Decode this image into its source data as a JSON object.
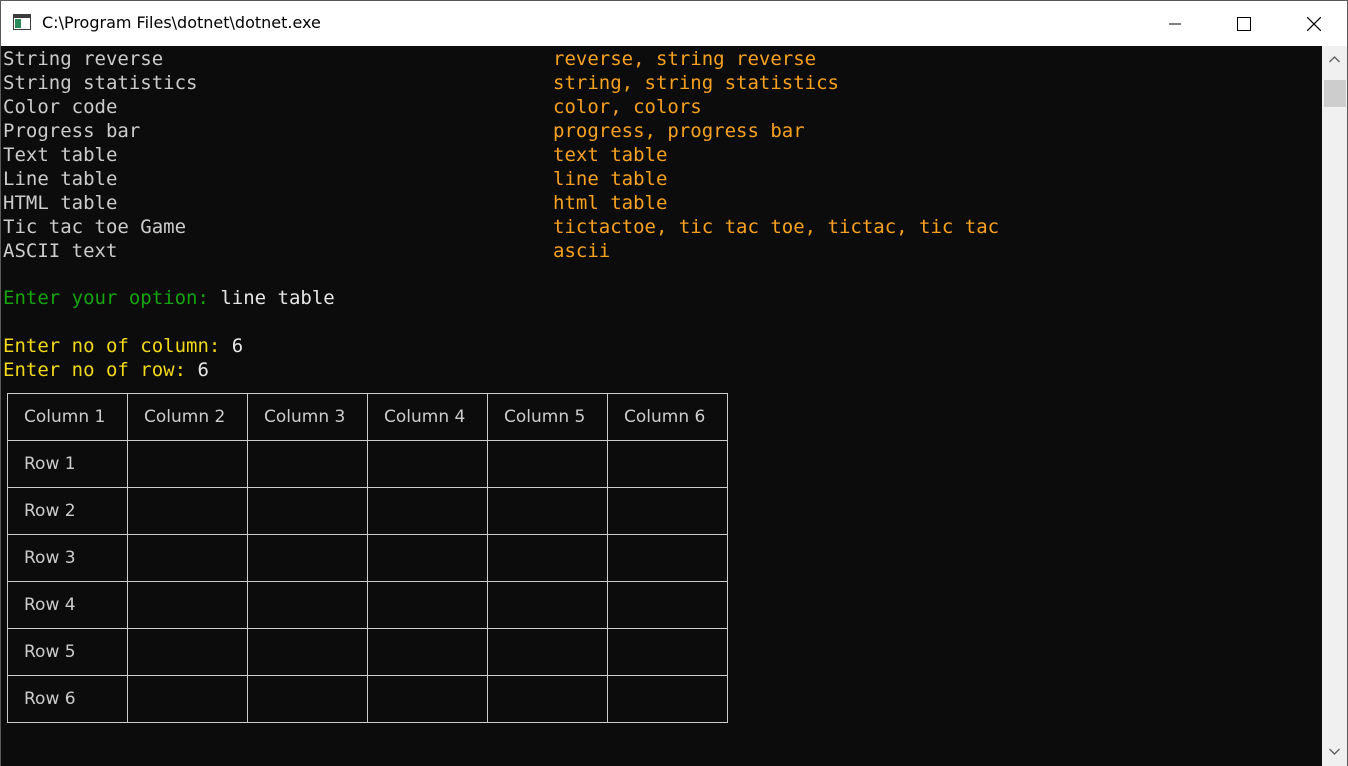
{
  "window": {
    "title": "C:\\Program Files\\dotnet\\dotnet.exe",
    "app_icon": "console-icon",
    "controls": {
      "minimize": "minimize-icon",
      "maximize": "maximize-icon",
      "close": "close-icon"
    }
  },
  "menu": [
    {
      "name": "String reverse",
      "aliases": "reverse, string reverse"
    },
    {
      "name": "String statistics",
      "aliases": "string, string statistics"
    },
    {
      "name": "Color code",
      "aliases": "color, colors"
    },
    {
      "name": "Progress bar",
      "aliases": "progress, progress bar"
    },
    {
      "name": "Text table",
      "aliases": "text table"
    },
    {
      "name": "Line table",
      "aliases": "line table"
    },
    {
      "name": "HTML table",
      "aliases": "html table"
    },
    {
      "name": "Tic tac toe Game",
      "aliases": "tictactoe, tic tac toe, tictac, tic tac"
    },
    {
      "name": "ASCII text",
      "aliases": "ascii"
    }
  ],
  "prompt": {
    "label": "Enter your option: ",
    "value": "line table"
  },
  "columns_prompt": {
    "label": "Enter no of column: ",
    "value": "6"
  },
  "rows_prompt": {
    "label": "Enter no of row: ",
    "value": "6"
  },
  "table": {
    "headers": [
      "Column 1",
      "Column 2",
      "Column 3",
      "Column 4",
      "Column 5",
      "Column 6"
    ],
    "rows": [
      [
        "Row 1",
        "",
        "",
        "",
        "",
        ""
      ],
      [
        "Row 2",
        "",
        "",
        "",
        "",
        ""
      ],
      [
        "Row 3",
        "",
        "",
        "",
        "",
        ""
      ],
      [
        "Row 4",
        "",
        "",
        "",
        "",
        ""
      ],
      [
        "Row 5",
        "",
        "",
        "",
        "",
        ""
      ],
      [
        "Row 6",
        "",
        "",
        "",
        "",
        ""
      ]
    ]
  },
  "scrollbar": {
    "up": "chevron-up-icon",
    "down": "chevron-down-icon"
  },
  "colors": {
    "background": "#0c0c0c",
    "text": "#cccccc",
    "alias": "#f7a120",
    "prompt_green": "#16a40e",
    "prompt_yellow": "#f2d81a"
  }
}
